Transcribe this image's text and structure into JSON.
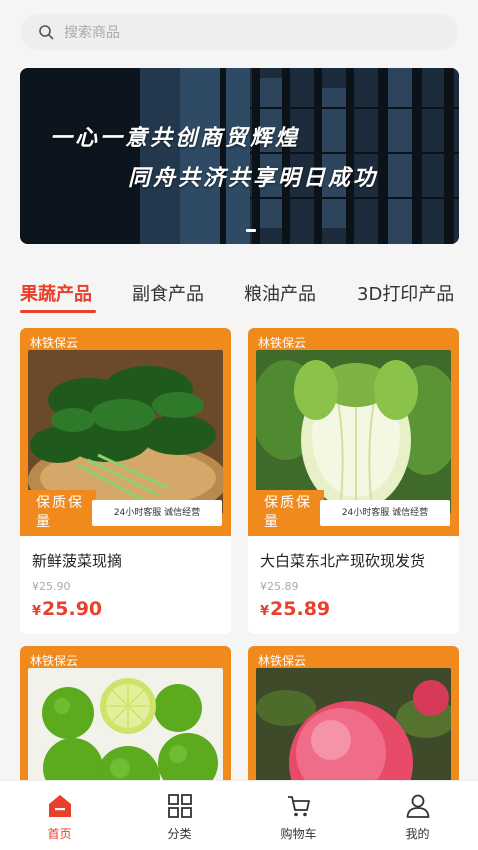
{
  "search": {
    "placeholder": "搜索商品",
    "icon": "search-icon"
  },
  "banner": {
    "line1": "一心一意共创商贸辉煌",
    "line2": "同舟共济共享明日成功"
  },
  "tabs": [
    {
      "label": "果蔬产品",
      "active": true
    },
    {
      "label": "副食产品",
      "active": false
    },
    {
      "label": "粮油产品",
      "active": false
    },
    {
      "label": "3D打印产品",
      "active": false
    }
  ],
  "products": [
    {
      "tag": "林铁保云",
      "badge_left": "保质保量",
      "badge_right": "24小时客服  诚信经营",
      "name": "新鲜菠菜现摘",
      "old_price": "¥25.90",
      "currency": "¥",
      "price": "25.90"
    },
    {
      "tag": "林铁保云",
      "badge_left": "保质保量",
      "badge_right": "24小时客服  诚信经营",
      "name": "大白菜东北产现砍现发货",
      "old_price": "¥25.89",
      "currency": "¥",
      "price": "25.89"
    },
    {
      "tag": "林铁保云",
      "badge_left": "",
      "badge_right": "",
      "name": "",
      "old_price": "",
      "currency": "",
      "price": ""
    },
    {
      "tag": "林铁保云",
      "badge_left": "",
      "badge_right": "",
      "name": "",
      "old_price": "",
      "currency": "",
      "price": ""
    }
  ],
  "bottom_nav": [
    {
      "label": "首页",
      "icon": "home-icon",
      "active": true
    },
    {
      "label": "分类",
      "icon": "grid-icon",
      "active": false
    },
    {
      "label": "购物车",
      "icon": "cart-icon",
      "active": false
    },
    {
      "label": "我的",
      "icon": "user-icon",
      "active": false
    }
  ],
  "colors": {
    "accent": "#e8402b",
    "orange_frame": "#f08a1c"
  }
}
